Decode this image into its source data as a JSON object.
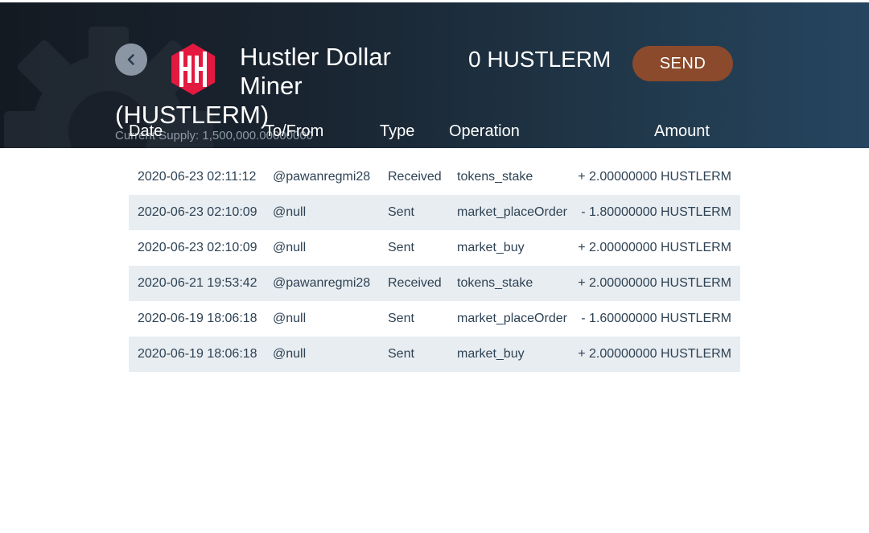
{
  "token": {
    "name_line1": "Hustler Dollar",
    "name_line2": "Miner",
    "symbol": "(HUSTLERM)",
    "supply": "Current Supply: 1,500,000.00000000",
    "logo_icon": "hustler-hh-logo-icon",
    "logo_color": "#e3193f"
  },
  "balance": "0 HUSTLERM",
  "send_label": "SEND",
  "colors": {
    "send": "#8b4a2b",
    "row_alt": "#e8edf1"
  },
  "columns": [
    "Date",
    "To/From",
    "Type",
    "Operation",
    "Amount"
  ],
  "rows": [
    {
      "date": "2020-06-23 02:11:12",
      "to": "@pawanregmi28",
      "type": "Received",
      "op": "tokens_stake",
      "amount": "+ 2.00000000 HUSTLERM"
    },
    {
      "date": "2020-06-23 02:10:09",
      "to": "@null",
      "type": "Sent",
      "op": "market_placeOrder",
      "amount": "- 1.80000000 HUSTLERM"
    },
    {
      "date": "2020-06-23 02:10:09",
      "to": "@null",
      "type": "Sent",
      "op": "market_buy",
      "amount": "+ 2.00000000 HUSTLERM"
    },
    {
      "date": "2020-06-21 19:53:42",
      "to": "@pawanregmi28",
      "type": "Received",
      "op": "tokens_stake",
      "amount": "+ 2.00000000 HUSTLERM"
    },
    {
      "date": "2020-06-19 18:06:18",
      "to": "@null",
      "type": "Sent",
      "op": "market_placeOrder",
      "amount": "- 1.60000000 HUSTLERM"
    },
    {
      "date": "2020-06-19 18:06:18",
      "to": "@null",
      "type": "Sent",
      "op": "market_buy",
      "amount": "+ 2.00000000 HUSTLERM"
    }
  ]
}
